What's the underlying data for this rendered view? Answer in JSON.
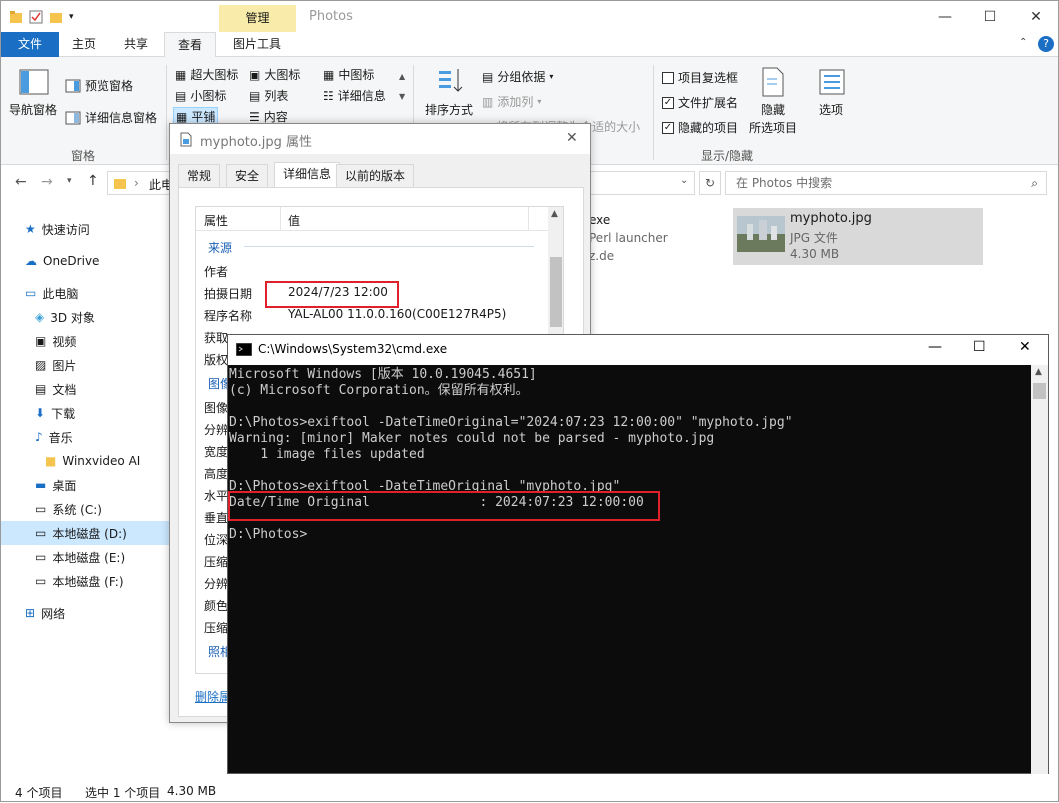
{
  "explorer": {
    "title": "Photos",
    "contextual_tab": "管理",
    "tabs": [
      "文件",
      "主页",
      "共享",
      "查看",
      "图片工具"
    ],
    "ribbon": {
      "panes": {
        "nav_pane": "导航窗格",
        "preview": "预览窗格",
        "details": "详细信息窗格",
        "group": "窗格"
      },
      "layout": {
        "xl": "超大图标",
        "large": "大图标",
        "medium": "中图标",
        "small": "小图标",
        "list": "列表",
        "details": "详细信息",
        "tiles": "平铺",
        "content": "内容"
      },
      "current_view": {
        "sort": "排序方式",
        "group_by": "分组依据",
        "add_column": "添加列",
        "fit": "将所有列调整为合适的大小"
      },
      "show_hide": {
        "item_check": "项目复选框",
        "extensions": "文件扩展名",
        "hidden_items": "隐藏的项目",
        "hide_selected": "隐藏",
        "hide_selected2": "所选项目",
        "options": "选项",
        "group": "显示/隐藏"
      }
    },
    "address_crumb": "此电",
    "search_placeholder": "在 Photos 中搜索",
    "nav": [
      "快速访问",
      "OneDrive",
      "此电脑",
      "3D 对象",
      "视频",
      "图片",
      "文档",
      "下载",
      "音乐",
      "Winxvideo AI",
      "桌面",
      "系统 (C:)",
      "本地磁盘 (D:)",
      "本地磁盘 (E:)",
      "本地磁盘 (F:)",
      "网络"
    ],
    "files": {
      "exe_name": "exe",
      "exe_desc": "Perl launcher",
      "exe_pub": "z.de",
      "photo_name": "myphoto.jpg",
      "photo_type": "JPG 文件",
      "photo_size": "4.30 MB"
    },
    "status": {
      "count": "4 个项目",
      "selected": "选中 1 个项目",
      "size": "4.30 MB"
    }
  },
  "properties": {
    "title": "myphoto.jpg 属性",
    "tabs": [
      "常规",
      "安全",
      "详细信息",
      "以前的版本"
    ],
    "col_prop": "属性",
    "col_val": "值",
    "section_source": "来源",
    "rows": [
      {
        "k": "作者",
        "v": ""
      },
      {
        "k": "拍摄日期",
        "v": "2024/7/23 12:00"
      },
      {
        "k": "程序名称",
        "v": "YAL-AL00 11.0.0.160(C00E127R4P5)"
      },
      {
        "k": "获取",
        "v": ""
      },
      {
        "k": "版权",
        "v": ""
      }
    ],
    "section_image": "图像",
    "rows2": [
      "图像",
      "分辨",
      "宽度",
      "高度",
      "水平",
      "垂直",
      "位深",
      "压缩",
      "分辨",
      "颜色",
      "压缩"
    ],
    "section_camera": "照相",
    "remove_link": "删除属"
  },
  "cmd": {
    "title": "C:\\Windows\\System32\\cmd.exe",
    "lines": [
      "Microsoft Windows [版本 10.0.19045.4651]",
      "(c) Microsoft Corporation。保留所有权利。",
      "",
      "D:\\Photos>exiftool -DateTimeOriginal=\"2024:07:23 12:00:00\" \"myphoto.jpg\"",
      "Warning: [minor] Maker notes could not be parsed - myphoto.jpg",
      "    1 image files updated",
      "",
      "D:\\Photos>exiftool -DateTimeOriginal \"myphoto.jpg\"",
      "Date/Time Original              : 2024:07:23 12:00:00",
      "",
      "D:\\Photos>"
    ]
  },
  "colors": {
    "accent": "#1a6fc4",
    "highlight": "#e0202a",
    "context_tab": "#f9ecaa"
  }
}
